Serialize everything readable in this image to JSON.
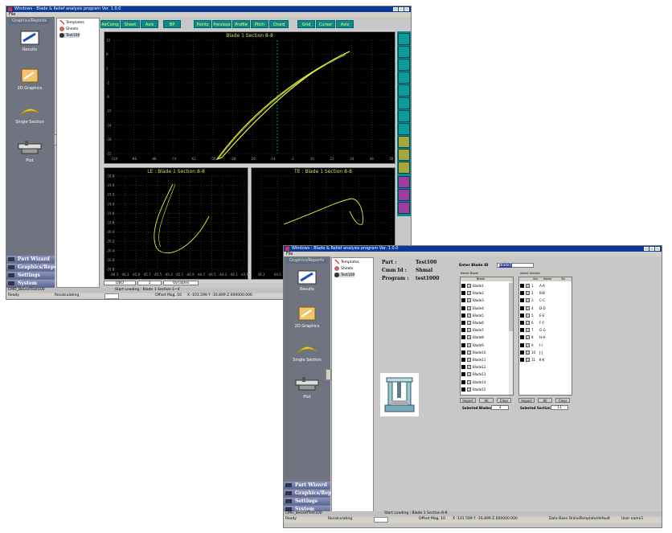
{
  "windowA": {
    "title": "Windows - Blade & Relief analysis program Ver. 1.0.0",
    "menu": "File",
    "sidebar_header": "Graphics/Reports",
    "sidebar_items": [
      "Results",
      "2D Graphics",
      "Single Section",
      "Plot"
    ],
    "sidebar_bars": [
      "Part Wizard",
      "Graphics/Reports",
      "Settings",
      "System"
    ],
    "tree": [
      "Templates",
      "Sheets",
      "Test100"
    ],
    "toolbar": [
      "AirComp",
      "Sheet",
      "Axis",
      "BP",
      "Points",
      "Previous",
      "Profile",
      "Pitch",
      "Chord",
      "Grid",
      "Cursor",
      "Axis"
    ],
    "main_plot_title": "Blade 1 Section 8-8",
    "le_plot_title": "LE : Blade 1 Section 8-8",
    "te_plot_title": "TE : Blade 1 Section 8-8",
    "main_x_ticks": [
      "-110",
      "-98",
      "-86",
      "-74",
      "-62",
      "-50",
      "-38",
      "-26",
      "-14",
      "-2",
      "10",
      "22",
      "34",
      "46",
      "58"
    ],
    "main_y_ticks": [
      "10",
      "6",
      "2",
      "-2",
      "-6",
      "-10",
      "-14",
      "-18",
      "-22"
    ],
    "le_x_ticks": [
      "-46.3",
      "-46.1",
      "-45.9",
      "-45.7",
      "-45.5",
      "-45.3",
      "-45.1",
      "-44.9",
      "-44.7",
      "-44.5",
      "-44.3",
      "-44.1",
      "-43.9"
    ],
    "le_y_ticks": [
      "-18.8",
      "-19.0",
      "-19.2",
      "-19.4",
      "-19.6",
      "-19.8",
      "-20.0",
      "-20.2",
      "-20.4",
      "-20.6",
      "-20.8"
    ],
    "te_x_ticks": [
      "44.3",
      "44.5",
      "44.7",
      "44.9",
      "45.1",
      "45.3",
      "45.5",
      "45.7",
      "45.9"
    ],
    "bottom_fields": [
      "DBO",
      "1",
      "Variables"
    ],
    "status_file": "CMO_BeLeafTest100",
    "status_msg": "Start Loading : Blade 1 Section 1~4",
    "status_left": "Ready",
    "status_recalc": "Recalculating",
    "status_offset": "Offset Mag. 10",
    "status_coords": "X -101.599 Y -16.899 Z.000000.000"
  },
  "windowB": {
    "title": "Windows - Blade & Relief analysis program Ver. 1.0.0",
    "menu": "File",
    "sidebar_header": "Graphics/Reports",
    "sidebar_items": [
      "Results",
      "2D Graphics",
      "Single Section",
      "Plot"
    ],
    "sidebar_bars": [
      "Part Wizard",
      "Graphics/Reports",
      "Settings",
      "System"
    ],
    "tree": [
      "Templates",
      "Sheets",
      "Test100"
    ],
    "part_label": "Part :",
    "part_value": "Test100",
    "cmm_label": "Cmm Id :",
    "cmm_value": "Shmal",
    "program_label": "Program :",
    "program_value": "test1000",
    "enter_blade_label": "Enter Blade ID",
    "enter_blade_value": "Blade1",
    "select_blade_label": "Select Blade",
    "select_section_label": "Select Section",
    "blade_header": "Blade",
    "blades": [
      "Blade1",
      "Blade2",
      "Blade3",
      "Blade4",
      "Blade5",
      "Blade6",
      "Blade7",
      "Blade8",
      "Blade9",
      "Blade10",
      "Blade11",
      "Blade12",
      "Blade13",
      "Blade14",
      "Blade15"
    ],
    "section_headers": [
      "Sec",
      "Name",
      "Tol"
    ],
    "sections": [
      {
        "num": "1",
        "name": "A-A"
      },
      {
        "num": "2",
        "name": "B-B"
      },
      {
        "num": "3",
        "name": "C-C"
      },
      {
        "num": "4",
        "name": "D-D"
      },
      {
        "num": "5",
        "name": "E-E"
      },
      {
        "num": "6",
        "name": "F-F"
      },
      {
        "num": "7",
        "name": "G-G"
      },
      {
        "num": "8",
        "name": "H-H"
      },
      {
        "num": "9",
        "name": "I-I"
      },
      {
        "num": "10",
        "name": "J-J"
      },
      {
        "num": "11",
        "name": "K-K"
      }
    ],
    "buttons_blade": [
      "Import",
      "All",
      "Clear"
    ],
    "buttons_section": [
      "Import",
      "All",
      "Clear"
    ],
    "selected_blades_label": "Selected Blades",
    "selected_blades_value": "3",
    "selected_sections_label": "Selected Sections",
    "selected_sections_value": "11",
    "status_file": "CMO_BeLeafTest100",
    "status_msg": "Start Loading : Blade 1 Section 8-8",
    "status_left": "Ready",
    "status_recalc": "Recalculating",
    "status_offset": "Offset Mag. 10",
    "status_coords": "X -101.599 Y -16.899 Z.000000.000",
    "status_db": "Data Base Online",
    "status_template": "Template/default",
    "status_user": "User name1"
  },
  "colors": {
    "plot_bg": "#000000",
    "curve": "#e6ef3a",
    "grid": "#2f5e2f",
    "toolbar": "#0b8a8a",
    "sidebar": "#6f7480",
    "title": "#0a3a9a"
  }
}
